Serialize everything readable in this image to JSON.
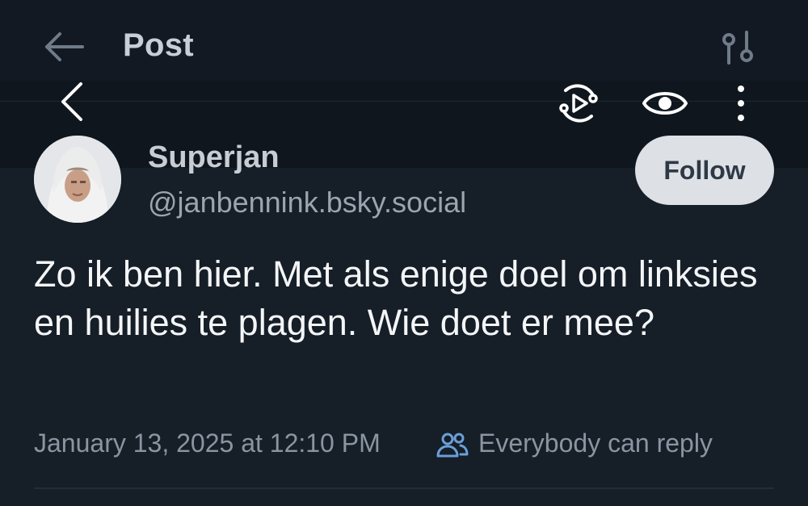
{
  "header": {
    "title": "Post",
    "back_icon": "arrow-left-icon",
    "settings_icon": "sliders-icon"
  },
  "overlay_toolbar": {
    "back_icon": "chevron-left-icon",
    "play_icon": "play-circle-icon",
    "eye_icon": "eye-icon",
    "more_icon": "more-vertical-icon"
  },
  "author": {
    "name": "Superjan",
    "handle": "@janbennink.bsky.social",
    "avatar_icon": "avatar"
  },
  "follow_button": {
    "label": "Follow"
  },
  "post": {
    "text": "Zo ik ben hier. Met als enige doel om linksies en huilies te plagen. Wie doet er mee?",
    "date": "January 13, 2025 at 12:10 PM",
    "reply_setting": "Everybody can reply",
    "reply_icon": "people-icon"
  },
  "colors": {
    "background": "#161e27",
    "header_background": "#121922",
    "accent_follow": "#dde1e6",
    "muted_text": "#8b95a2",
    "reply_icon_color": "#6b9fd8"
  }
}
